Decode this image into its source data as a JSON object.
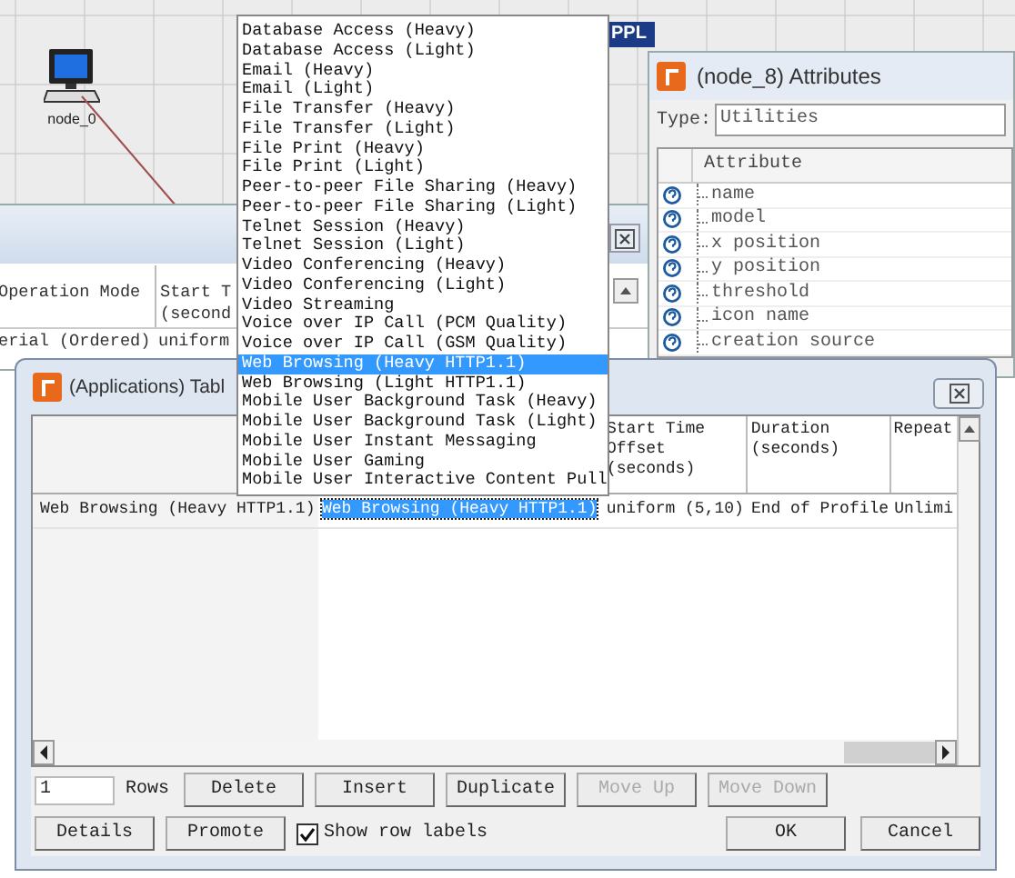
{
  "canvas": {
    "nodes": [
      {
        "label": "node_0"
      }
    ],
    "tab_label": "PPL"
  },
  "background_window": {
    "columns": [
      "Operation Mode",
      "Start T\n(second"
    ],
    "rows": [
      [
        "erial (Ordered)",
        "uniform"
      ]
    ]
  },
  "attributes_window": {
    "title": "(node_8) Attributes",
    "type_label": "Type:",
    "type_value": "Utilities",
    "column": "Attribute",
    "rows": [
      "name",
      "model",
      "x position",
      "y position",
      "threshold",
      "icon name",
      "creation source"
    ]
  },
  "table_window": {
    "title": "(Applications) Tabl",
    "columns": [
      "",
      "Start Time\nOffset\n(seconds)",
      "Duration\n(seconds)",
      "Repeat"
    ],
    "rows": [
      {
        "label": "Web Browsing (Heavy HTTP1.1)",
        "cells": [
          {
            "text": "Web Browsing (Heavy HTTP1.1)",
            "selected": true
          },
          {
            "text": "uniform (5,10)",
            "selected": false
          },
          {
            "text": "End of Profile",
            "selected": false
          },
          {
            "text": "Unlimi",
            "selected": false
          }
        ]
      }
    ],
    "rows_count": "1",
    "rows_label": "Rows",
    "edit_buttons": [
      {
        "label": "Delete",
        "disabled": false
      },
      {
        "label": "Insert",
        "disabled": false
      },
      {
        "label": "Duplicate",
        "disabled": false
      },
      {
        "label": "Move Up",
        "disabled": true
      },
      {
        "label": "Move Down",
        "disabled": true
      }
    ],
    "left_buttons": [
      {
        "label": "Details",
        "disabled": false
      },
      {
        "label": "Promote",
        "disabled": false
      }
    ],
    "show_row_labels": {
      "label": "Show row labels",
      "checked": true
    },
    "dialog_buttons": [
      {
        "label": "OK",
        "disabled": false
      },
      {
        "label": "Cancel",
        "disabled": false
      }
    ]
  },
  "menu": {
    "items": [
      {
        "label": "Database Access (Heavy)",
        "selected": false
      },
      {
        "label": "Database Access (Light)",
        "selected": false
      },
      {
        "label": "Email (Heavy)",
        "selected": false
      },
      {
        "label": "Email (Light)",
        "selected": false
      },
      {
        "label": "File Transfer (Heavy)",
        "selected": false
      },
      {
        "label": "File Transfer (Light)",
        "selected": false
      },
      {
        "label": "File Print (Heavy)",
        "selected": false
      },
      {
        "label": "File Print (Light)",
        "selected": false
      },
      {
        "label": "Peer-to-peer File Sharing (Heavy)",
        "selected": false
      },
      {
        "label": "Peer-to-peer File Sharing (Light)",
        "selected": false
      },
      {
        "label": "Telnet Session (Heavy)",
        "selected": false
      },
      {
        "label": "Telnet Session (Light)",
        "selected": false
      },
      {
        "label": "Video Conferencing (Heavy)",
        "selected": false
      },
      {
        "label": "Video Conferencing (Light)",
        "selected": false
      },
      {
        "label": "Video Streaming",
        "selected": false
      },
      {
        "label": "Voice over IP Call (PCM Quality)",
        "selected": false
      },
      {
        "label": "Voice over IP Call (GSM Quality)",
        "selected": false
      },
      {
        "label": "Web Browsing (Heavy HTTP1.1)",
        "selected": true
      },
      {
        "label": "Web Browsing (Light HTTP1.1)",
        "selected": false
      },
      {
        "label": "Mobile User Background Task (Heavy)",
        "selected": false
      },
      {
        "label": "Mobile User Background Task (Light)",
        "selected": false
      },
      {
        "label": "Mobile User Instant Messaging",
        "selected": false
      },
      {
        "label": "Mobile User Gaming",
        "selected": false
      },
      {
        "label": "Mobile User Interactive Content Pull",
        "selected": false
      }
    ]
  }
}
